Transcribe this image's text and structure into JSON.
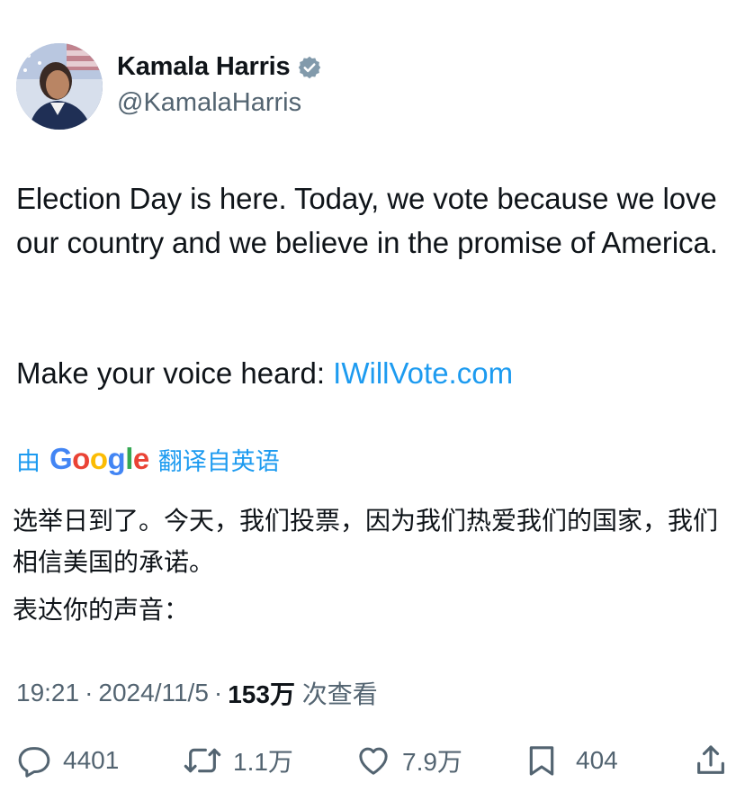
{
  "author": {
    "display_name": "Kamala Harris",
    "handle": "@KamalaHarris",
    "verified_icon": "verified-badge-icon"
  },
  "tweet": {
    "text_main": "Election Day is here. Today, we vote because we love our country and we believe in the promise of America.",
    "text_prefix": "Make your voice heard: ",
    "link_text": "IWillVote.com"
  },
  "translation": {
    "prefix": "由",
    "google_letters": [
      "G",
      "o",
      "o",
      "g",
      "l",
      "e"
    ],
    "suffix": "翻译自英语",
    "paragraph1": "选举日到了。今天，我们投票，因为我们热爱我们的国家，我们相信美国的承诺。",
    "paragraph2": "表达你的声音："
  },
  "meta": {
    "time": "19:21",
    "dot": "·",
    "date": "2024/11/5",
    "views_count": "153万",
    "views_label": " 次查看"
  },
  "actions": {
    "replies": "4401",
    "retweets": "1.1万",
    "likes": "7.9万",
    "bookmarks": "404"
  },
  "colors": {
    "link": "#1d9bf0",
    "text": "#0f1419",
    "secondary": "#536471",
    "google_blue": "#4285f4",
    "google_red": "#ea4335",
    "google_yellow": "#fbbc05",
    "google_green": "#34a853"
  }
}
